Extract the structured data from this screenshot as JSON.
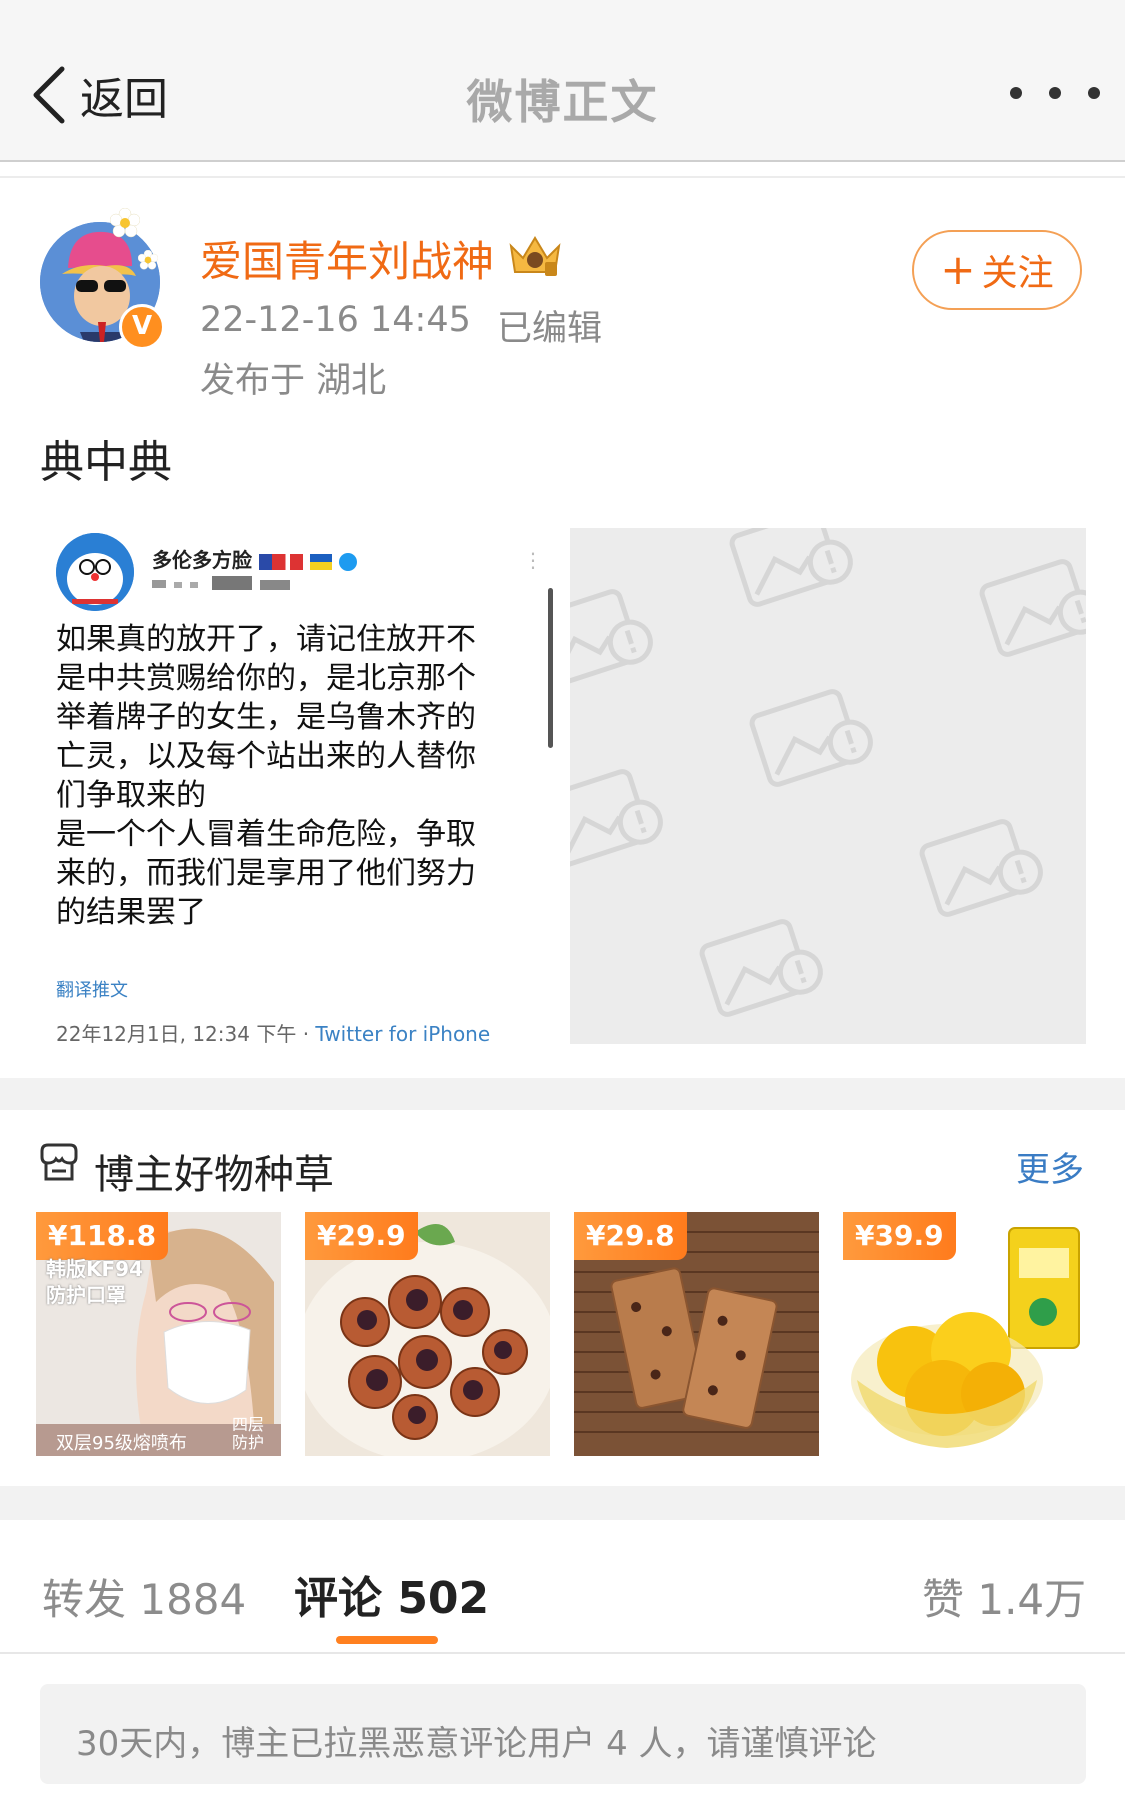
{
  "nav": {
    "back_label": "返回",
    "title": "微博正文"
  },
  "post": {
    "author": "爱国青年刘战神",
    "time": "22-12-16 14:45",
    "edited": "已编辑",
    "location": "发布于 湖北",
    "follow_label": "关注",
    "text": "典中典"
  },
  "tweet_image": {
    "name": "多伦多方脸",
    "body": "如果真的放开了，请记住放开不是中共赏赐给你的，是北京那个举着牌子的女生，是乌鲁木齐的亡灵，以及每个站出来的人替你们争取来的\n是一个个人冒着生命危险，争取来的，而我们是享用了他们努力的结果罢了",
    "translate": "翻译推文",
    "date": "22年12月1日, 12:34 下午 · ",
    "source": "Twitter for iPhone"
  },
  "shop": {
    "title": "博主好物种草",
    "more": "更多",
    "products": [
      {
        "price": "¥118.8",
        "line1": "韩版KF94",
        "line2": "防护口罩",
        "bottom": "双层95级熔喷布",
        "corner": "四层\n防护"
      },
      {
        "price": "¥29.9"
      },
      {
        "price": "¥29.8"
      },
      {
        "price": "¥39.9"
      }
    ]
  },
  "tabs": {
    "repost": "转发 1884",
    "comment": "评论 502",
    "like": "赞 1.4万"
  },
  "notice": "30天内，博主已拉黑恶意评论用户 4 人，请谨慎评论",
  "colors": {
    "accent": "#ff8020",
    "username": "#f06a14",
    "link": "#3a7cc4"
  }
}
